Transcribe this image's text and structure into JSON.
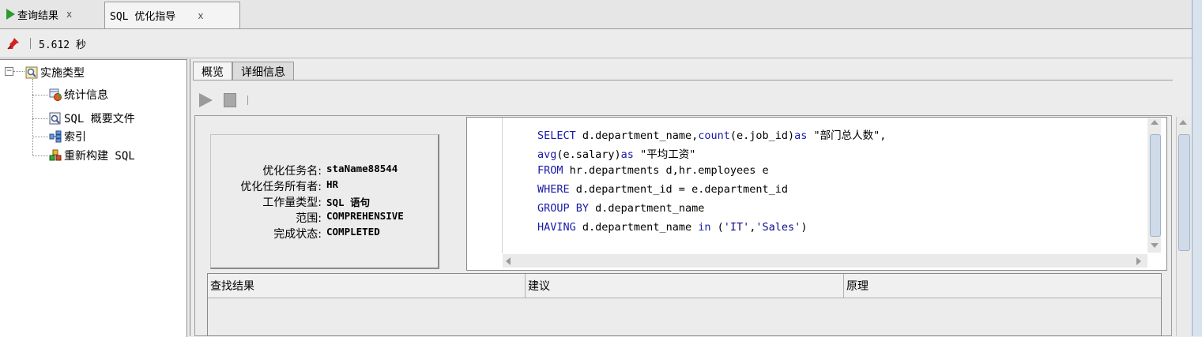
{
  "tabs": [
    {
      "label": "查询结果",
      "close": "x"
    },
    {
      "label": "SQL 优化指导",
      "close": "x"
    }
  ],
  "status": {
    "elapsed": "5.612 秒"
  },
  "tree": {
    "toggle": "−",
    "root": "实施类型",
    "children": [
      "统计信息",
      "SQL 概要文件",
      "索引",
      "重新构建 SQL"
    ]
  },
  "subtabs": [
    "概览",
    "详细信息"
  ],
  "summary": [
    {
      "label": "优化任务名:",
      "value": "staName88544"
    },
    {
      "label": "优化任务所有者:",
      "value": "HR"
    },
    {
      "label": "工作量类型:",
      "value": "SQL 语句"
    },
    {
      "label": "范围:",
      "value": "COMPREHENSIVE"
    },
    {
      "label": "完成状态:",
      "value": "COMPLETED"
    }
  ],
  "sql": {
    "l1_kw1": "SELECT",
    "l1_a": " d.department_name,",
    "l1_kw2": "count",
    "l1_b": "(e.job_id)",
    "l1_kw3": "as",
    "l1_c": " \"部门总人数\",",
    "l2_kw1": "avg",
    "l2_a": "(e.salary)",
    "l2_kw2": "as",
    "l2_b": " \"平均工资\"",
    "l3_kw1": "FROM",
    "l3_a": " hr.departments d,hr.employees e",
    "l4_kw1": "WHERE",
    "l4_a": " d.department_id = e.department_id",
    "l5_kw1": "GROUP BY",
    "l5_a": " d.department_name",
    "l6_kw1": "HAVING",
    "l6_a": " d.department_name ",
    "l6_kw2": "in",
    "l6_b": " (",
    "l6_s1": "'IT'",
    "l6_c": ",",
    "l6_s2": "'Sales'",
    "l6_d": ")"
  },
  "results": {
    "columns": [
      "查找结果",
      "建议",
      "原理"
    ]
  }
}
